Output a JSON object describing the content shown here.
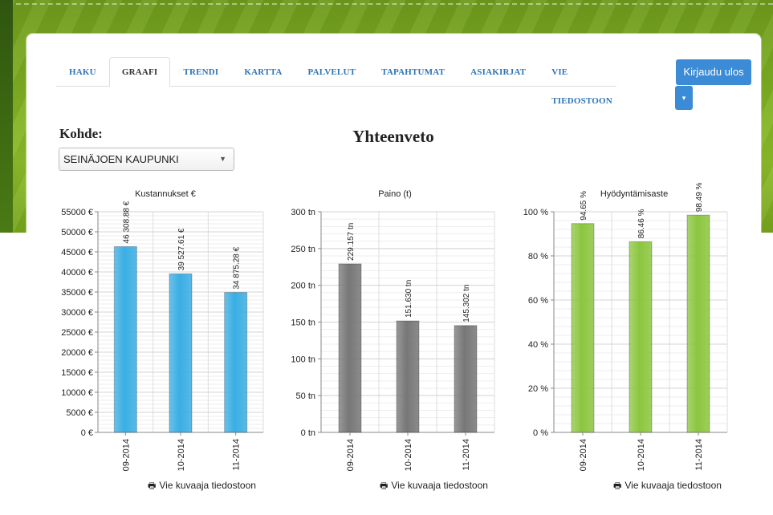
{
  "tabs": [
    "HAKU",
    "GRAAFI",
    "TRENDI",
    "KARTTA",
    "PALVELUT",
    "TAPAHTUMAT",
    "ASIAKIRJAT",
    "VIE TIEDOSTOON"
  ],
  "active_tab": "GRAAFI",
  "logout_label": "Kirjaudu ulos",
  "caret_icon": "▾",
  "kohde_label": "Kohde:",
  "kohde_select": "SEINÄJOEN KAUPUNKI",
  "select_arrow": "▼",
  "page_title": "Yhteenveto",
  "export_label": "Vie kuvaaja tiedostoon",
  "colors": {
    "accent": "#3c8bd6",
    "tab_link": "#2e74b5",
    "green_bg": "#7fae22"
  },
  "chart_data": [
    {
      "type": "bar",
      "title": "Kustannukset €",
      "categories": [
        "09-2014",
        "10-2014",
        "11-2014"
      ],
      "values": [
        46308.88,
        39527.61,
        34875.28
      ],
      "data_labels": [
        "46 308.88 €",
        "39 527.61 €",
        "34 875.28 €"
      ],
      "yticks": [
        "0 €",
        "5000 €",
        "10000 €",
        "15000 €",
        "20000 €",
        "25000 €",
        "30000 €",
        "35000 €",
        "40000 €",
        "45000 €",
        "50000 €",
        "55000 €"
      ],
      "ylim": [
        0,
        55000
      ],
      "color": "#3aaee4",
      "grid": true
    },
    {
      "type": "bar",
      "title": "Paino (t)",
      "categories": [
        "09-2014",
        "10-2014",
        "11-2014"
      ],
      "values": [
        229.157,
        151.63,
        145.302
      ],
      "data_labels": [
        "229.157 tn",
        "151.630 tn",
        "145.302 tn"
      ],
      "yticks": [
        "0 tn",
        "50 tn",
        "100 tn",
        "150 tn",
        "200 tn",
        "250 tn",
        "300 tn"
      ],
      "ylim": [
        0,
        300
      ],
      "color": "#777777",
      "grid": true
    },
    {
      "type": "bar",
      "title": "Hyödyntämisaste",
      "categories": [
        "09-2014",
        "10-2014",
        "11-2014"
      ],
      "values": [
        94.65,
        86.46,
        98.49
      ],
      "data_labels": [
        "94.65 %",
        "86.46 %",
        "98.49 %"
      ],
      "yticks": [
        "0 %",
        "20 %",
        "40 %",
        "60 %",
        "80 %",
        "100 %"
      ],
      "ylim": [
        0,
        100
      ],
      "color": "#8cc63f",
      "grid": true
    }
  ]
}
